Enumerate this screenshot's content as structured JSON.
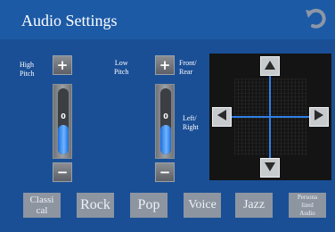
{
  "header": {
    "title": "Audio Settings",
    "back_icon": "undo-arrow-icon"
  },
  "labels": {
    "high_pitch": "High\nPitch",
    "low_pitch": "Low\nPitch",
    "front_rear": "Front/\nRear",
    "left_right": "Left/\nRight"
  },
  "sliders": {
    "high": {
      "value": "0",
      "level": 0.45,
      "plus": "+",
      "minus": "−"
    },
    "low": {
      "value": "0",
      "level": 0.45,
      "plus": "+",
      "minus": "−"
    }
  },
  "balance_pad": {
    "up_icon": "triangle-up-icon",
    "down_icon": "triangle-down-icon",
    "left_icon": "triangle-left-icon",
    "right_icon": "triangle-right-icon",
    "crosshair_color": "#2f7fe6"
  },
  "presets": [
    {
      "label": "Classi\ncal"
    },
    {
      "label": "Rock"
    },
    {
      "label": "Pop"
    },
    {
      "label": "Voice"
    },
    {
      "label": "Jazz"
    },
    {
      "label": "Persona\nlized\nAudio"
    }
  ],
  "colors": {
    "background": "#1a4f96",
    "header": "#1c5aa6",
    "slider_fill": "#3d8ff5",
    "preset_button": "#8d95a1"
  }
}
